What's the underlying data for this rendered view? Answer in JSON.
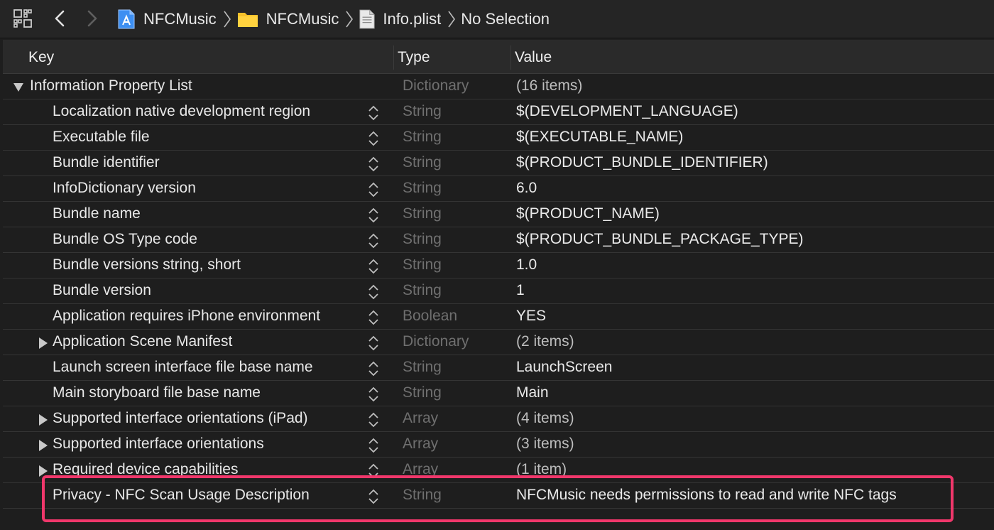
{
  "breadcrumbs": [
    {
      "label": "NFCMusic",
      "icon": "xcode-project-icon"
    },
    {
      "label": "NFCMusic",
      "icon": "folder-icon"
    },
    {
      "label": "Info.plist",
      "icon": "plist-file-icon"
    },
    {
      "label": "No Selection",
      "icon": ""
    }
  ],
  "columns": {
    "key": "Key",
    "type": "Type",
    "value": "Value"
  },
  "rows": [
    {
      "key": "Information Property List",
      "type": "Dictionary",
      "value": "(16 items)",
      "disclosure": "expanded",
      "level": 0
    },
    {
      "key": "Localization native development region",
      "type": "String",
      "value": "$(DEVELOPMENT_LANGUAGE)",
      "disclosure": "none",
      "level": 1
    },
    {
      "key": "Executable file",
      "type": "String",
      "value": "$(EXECUTABLE_NAME)",
      "disclosure": "none",
      "level": 1
    },
    {
      "key": "Bundle identifier",
      "type": "String",
      "value": "$(PRODUCT_BUNDLE_IDENTIFIER)",
      "disclosure": "none",
      "level": 1
    },
    {
      "key": "InfoDictionary version",
      "type": "String",
      "value": "6.0",
      "disclosure": "none",
      "level": 1
    },
    {
      "key": "Bundle name",
      "type": "String",
      "value": "$(PRODUCT_NAME)",
      "disclosure": "none",
      "level": 1
    },
    {
      "key": "Bundle OS Type code",
      "type": "String",
      "value": "$(PRODUCT_BUNDLE_PACKAGE_TYPE)",
      "disclosure": "none",
      "level": 1
    },
    {
      "key": "Bundle versions string, short",
      "type": "String",
      "value": "1.0",
      "disclosure": "none",
      "level": 1
    },
    {
      "key": "Bundle version",
      "type": "String",
      "value": "1",
      "disclosure": "none",
      "level": 1
    },
    {
      "key": "Application requires iPhone environment",
      "type": "Boolean",
      "value": "YES",
      "disclosure": "none",
      "level": 1
    },
    {
      "key": "Application Scene Manifest",
      "type": "Dictionary",
      "value": "(2 items)",
      "disclosure": "collapsed",
      "level": 1
    },
    {
      "key": "Launch screen interface file base name",
      "type": "String",
      "value": "LaunchScreen",
      "disclosure": "none",
      "level": 1
    },
    {
      "key": "Main storyboard file base name",
      "type": "String",
      "value": "Main",
      "disclosure": "none",
      "level": 1
    },
    {
      "key": "Supported interface orientations (iPad)",
      "type": "Array",
      "value": "(4 items)",
      "disclosure": "collapsed",
      "level": 1
    },
    {
      "key": "Supported interface orientations",
      "type": "Array",
      "value": "(3 items)",
      "disclosure": "collapsed",
      "level": 1
    },
    {
      "key": "Required device capabilities",
      "type": "Array",
      "value": "(1 item)",
      "disclosure": "collapsed",
      "level": 1
    },
    {
      "key": "Privacy - NFC Scan Usage Description",
      "type": "String",
      "value": "NFCMusic needs permissions to read and write NFC tags",
      "disclosure": "none",
      "level": 1
    }
  ],
  "colors": {
    "highlight": "#f0376b",
    "background": "#1e1e1e"
  }
}
